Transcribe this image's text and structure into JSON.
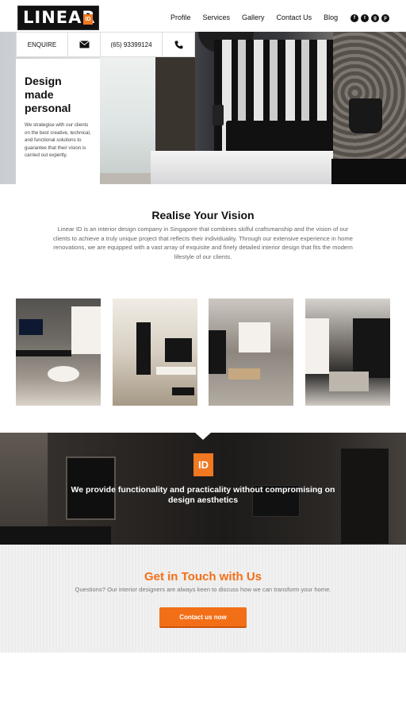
{
  "header": {
    "logo_text": "LINEAR",
    "logo_badge": "ID",
    "nav": [
      "Profile",
      "Services",
      "Gallery",
      "Contact Us",
      "Blog"
    ],
    "social_icons": [
      "facebook-icon",
      "twitter-icon",
      "google-plus-icon",
      "pinterest-icon"
    ],
    "social_glyphs": [
      "f",
      "t",
      "g",
      "p"
    ]
  },
  "enquire_bar": {
    "enquire_label": "ENQUIRE",
    "phone": "(65) 93399124"
  },
  "hero": {
    "title": "Design made personal",
    "text": "We strategise with our clients on the best creative, technical, and functional solutions to guarantee that their vision is carried out expertly."
  },
  "intro": {
    "title": "Realise Your Vision",
    "text": "Linear ID is an interior design company in Singapore that combines skilful craftsmanship and the vision of our clients to achieve a truly unique project that reflects their individuality. Through our extensive experience in home renovations, we are equipped with a vast array of exquisite and finely detailed interior design that fits the modern lifestyle of our clients."
  },
  "banner": {
    "badge": "ID",
    "text": "We provide functionality and practicality without compromising on design aesthetics"
  },
  "contact": {
    "title": "Get in Touch with Us",
    "text": "Questions? Our interior designers are always keen to discuss how we can transform your home.",
    "button": "Contact us now"
  },
  "colors": {
    "accent": "#f26f18",
    "dark": "#111111"
  }
}
